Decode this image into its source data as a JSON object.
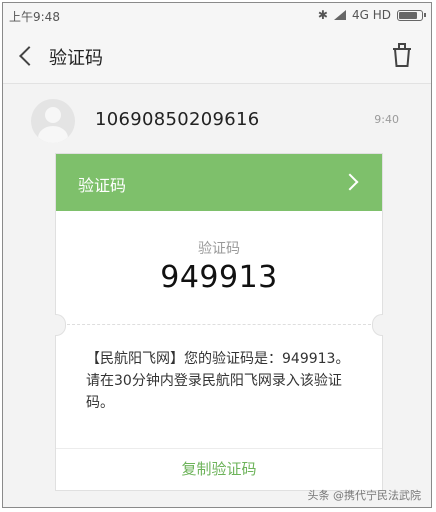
{
  "status_bar": {
    "time": "上午9:48",
    "network": "4G HD",
    "battery_level_pct": 90
  },
  "header": {
    "back_icon": "chevron-left-icon",
    "title": "验证码",
    "trash_icon": "trash-icon"
  },
  "message": {
    "sender": "10690850209616",
    "time": "9:40",
    "card": {
      "header_label": "验证码",
      "code_caption": "验证码",
      "code_value": "949913",
      "body_text": "【民航阳飞网】您的验证码是：949913。请在30分钟内登录民航阳飞网录入该验证码。",
      "copy_label": "复制验证码"
    }
  },
  "watermark": "头条 @携代宁民法武院",
  "colors": {
    "accent_green": "#7ec06b",
    "link_green": "#6db35a"
  }
}
